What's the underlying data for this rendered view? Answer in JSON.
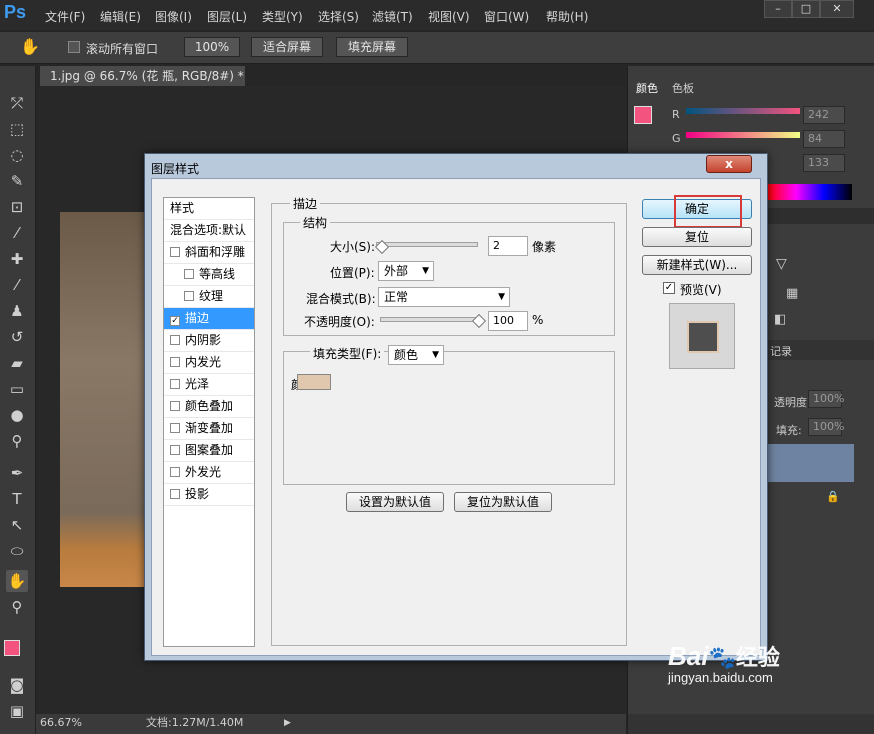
{
  "app": {
    "logo": "Ps"
  },
  "menu": [
    "文件(F)",
    "编辑(E)",
    "图像(I)",
    "图层(L)",
    "类型(Y)",
    "选择(S)",
    "滤镜(T)",
    "视图(V)",
    "窗口(W)",
    "帮助(H)"
  ],
  "options": {
    "scroll_all": "滚动所有窗口",
    "zoom": "100%",
    "fit_screen": "适合屏幕",
    "fill_screen": "填充屏幕"
  },
  "document": {
    "tab_title": "1.jpg @ 66.7% (花 瓶, RGB/8#) *",
    "zoom_status": "66.67%",
    "doc_info": "文档:1.27M/1.40M"
  },
  "panels": {
    "tabs": [
      "颜色",
      "色板"
    ],
    "color": {
      "r_label": "R",
      "g_label": "G",
      "r_value": "242",
      "g_value": "84",
      "b_value": "133",
      "fg": "#f2547f"
    },
    "history_tab": "记录",
    "opacity_label": "透明度:",
    "opacity_value": "100%",
    "fill_label": "填充:",
    "fill_value": "100%"
  },
  "dialog": {
    "title": "图层样式",
    "close": "x",
    "style_list": [
      {
        "label": "样式",
        "checkbox": false,
        "checked": false,
        "indent": false,
        "selected": false
      },
      {
        "label": "混合选项:默认",
        "checkbox": false,
        "checked": false,
        "indent": false,
        "selected": false
      },
      {
        "label": "斜面和浮雕",
        "checkbox": true,
        "checked": false,
        "indent": false,
        "selected": false
      },
      {
        "label": "等高线",
        "checkbox": true,
        "checked": false,
        "indent": true,
        "selected": false
      },
      {
        "label": "纹理",
        "checkbox": true,
        "checked": false,
        "indent": true,
        "selected": false
      },
      {
        "label": "描边",
        "checkbox": true,
        "checked": true,
        "indent": false,
        "selected": true
      },
      {
        "label": "内阴影",
        "checkbox": true,
        "checked": false,
        "indent": false,
        "selected": false
      },
      {
        "label": "内发光",
        "checkbox": true,
        "checked": false,
        "indent": false,
        "selected": false
      },
      {
        "label": "光泽",
        "checkbox": true,
        "checked": false,
        "indent": false,
        "selected": false
      },
      {
        "label": "颜色叠加",
        "checkbox": true,
        "checked": false,
        "indent": false,
        "selected": false
      },
      {
        "label": "渐变叠加",
        "checkbox": true,
        "checked": false,
        "indent": false,
        "selected": false
      },
      {
        "label": "图案叠加",
        "checkbox": true,
        "checked": false,
        "indent": false,
        "selected": false
      },
      {
        "label": "外发光",
        "checkbox": true,
        "checked": false,
        "indent": false,
        "selected": false
      },
      {
        "label": "投影",
        "checkbox": true,
        "checked": false,
        "indent": false,
        "selected": false
      }
    ],
    "stroke": {
      "group_title": "描边",
      "structure_title": "结构",
      "size_label": "大小(S):",
      "size_value": "2",
      "size_unit": "像素",
      "position_label": "位置(P):",
      "position_value": "外部",
      "blend_label": "混合模式(B):",
      "blend_value": "正常",
      "opacity_label": "不透明度(O):",
      "opacity_value": "100",
      "opacity_unit": "%",
      "fill_type_label": "填充类型(F):",
      "fill_type_value": "颜色",
      "color_label": "颜色:",
      "color": "#e0c8ae",
      "set_default": "设置为默认值",
      "reset_default": "复位为默认值"
    },
    "buttons": {
      "ok": "确定",
      "reset": "复位",
      "new_style": "新建样式(W)...",
      "preview": "预览(V)"
    }
  },
  "watermark": {
    "brand": "Bai",
    "brand2": "经验",
    "url": "jingyan.baidu.com"
  }
}
